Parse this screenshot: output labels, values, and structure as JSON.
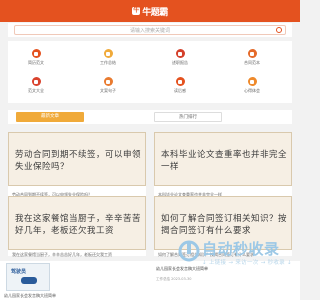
{
  "header": {
    "logo_text": "牛题霸"
  },
  "search": {
    "placeholder": "请输入搜索关键词"
  },
  "categories": [
    {
      "label": "简历范文",
      "color": "#e4521f"
    },
    {
      "label": "工作总结",
      "color": "#f0aa3a"
    },
    {
      "label": "述职报告",
      "color": "#d4402b"
    },
    {
      "label": "合同范本",
      "color": "#e46a2a"
    },
    {
      "label": "范文大全",
      "color": "#d9422d"
    },
    {
      "label": "文案句子",
      "color": "#e97b30"
    },
    {
      "label": "读后感",
      "color": "#e4521f"
    },
    {
      "label": "心得体会",
      "color": "#ef8a2c"
    }
  ],
  "tabs": {
    "latest": "最新文章",
    "hot": "热门排行"
  },
  "cards": [
    {
      "headline": "劳动合同到期不续签，可以申领失业保险吗？",
      "caption": "劳动合同到期不续签，可以申领失业保险吗？"
    },
    {
      "headline": "本科毕业论文查重率也并非完全一样",
      "caption": "本科毕业论文查重率也并非完全一样"
    },
    {
      "headline": "我在这家餐馆当厨子，辛辛苦苦好几年，老板还欠我工资",
      "caption": "我在这家餐馆当厨子，辛辛苦苦好几年，老板还欠我工资"
    },
    {
      "headline": "如何了解合同签订相关知识？按揭合同签订有什么要求",
      "caption": "如何了解合同签订相关知识？按揭合同签订有什么要求"
    }
  ],
  "bottom_items": [
    {
      "thumb_label": "驾驶员",
      "title": "幼儿园家长会发言稿大班简单"
    },
    {
      "title": "幼儿园家长会发言稿大班简单",
      "meta": "工作总结  2023-03-30"
    }
  ],
  "watermark": {
    "text": "自动秒收录",
    "subtitle": "↓ 上链接 → 来访一次 → 秒收录 ↓"
  }
}
